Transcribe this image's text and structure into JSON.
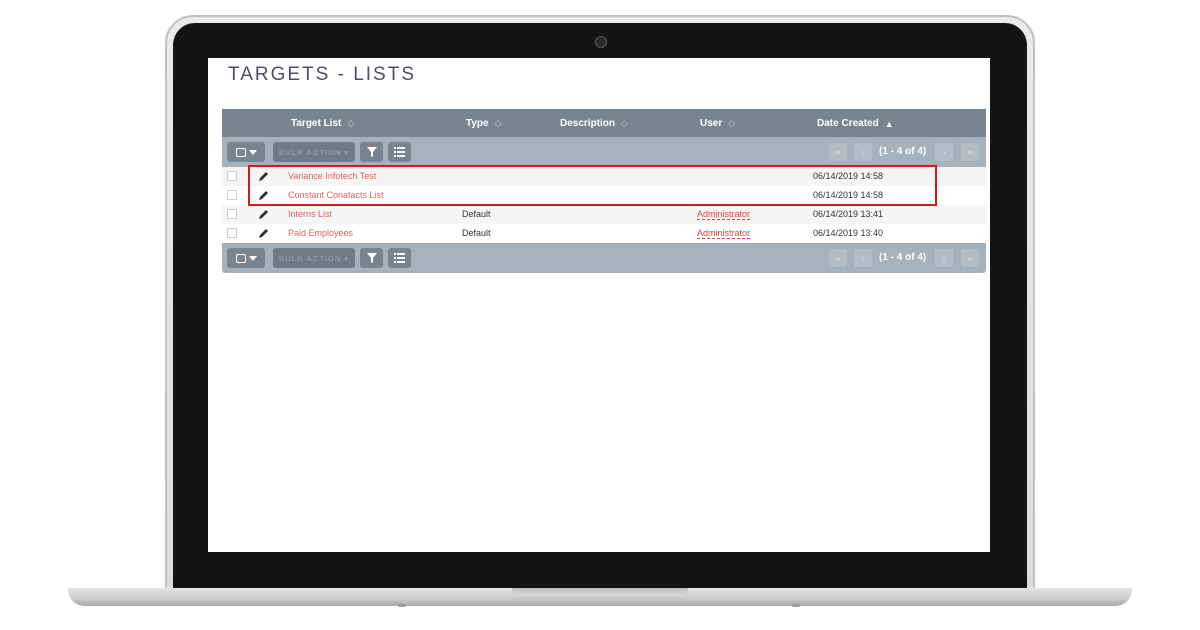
{
  "page": {
    "title": "TARGETS - LISTS"
  },
  "table": {
    "columns": [
      {
        "label": "Target List"
      },
      {
        "label": "Type"
      },
      {
        "label": "Description"
      },
      {
        "label": "User"
      },
      {
        "label": "Date Created",
        "sorted": "asc"
      }
    ],
    "toolbar": {
      "bulk_action_label": "BULK ACTION ▾",
      "pagination_text": "(1 - 4 of 4)"
    },
    "rows": [
      {
        "name": "Variance Infotech Test",
        "type": "",
        "description": "",
        "user": "",
        "date_created": "06/14/2019 14:58"
      },
      {
        "name": "Constant Conatacts List",
        "type": "",
        "description": "",
        "user": "",
        "date_created": "06/14/2019 14:58"
      },
      {
        "name": "Interns List",
        "type": "Default",
        "description": "",
        "user": "Administrator",
        "date_created": "06/14/2019 13:41"
      },
      {
        "name": "Paid Employees",
        "type": "Default",
        "description": "",
        "user": "Administrator",
        "date_created": "06/14/2019 13:40"
      }
    ]
  },
  "colors": {
    "header_bg": "#778591",
    "toolbar_bg": "#a5b1bb",
    "link": "#e0625d",
    "highlight_border": "#d9161a"
  }
}
